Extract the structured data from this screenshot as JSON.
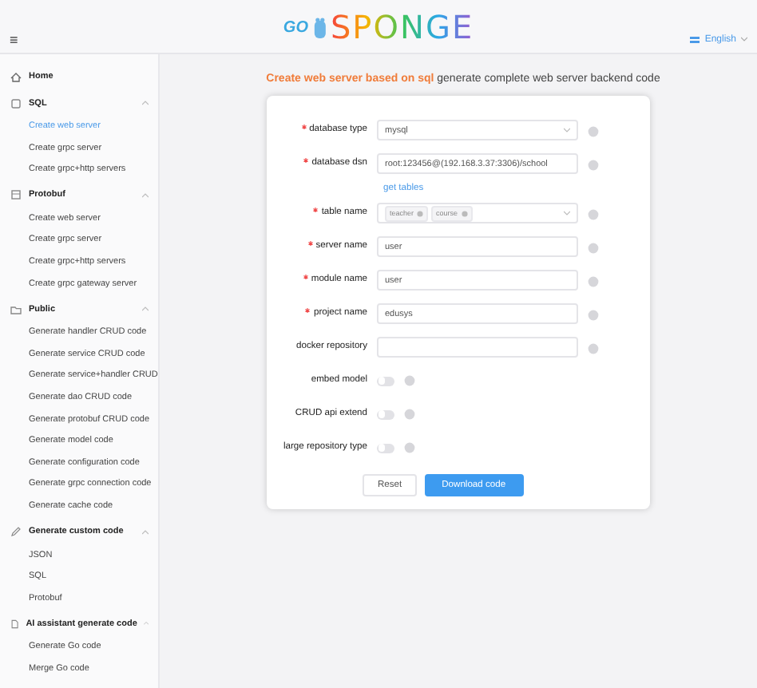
{
  "header": {
    "menu_icon": "≡",
    "logo": {
      "go": "GO",
      "name": "SPONGE"
    },
    "language": "English"
  },
  "sidebar": {
    "items": [
      {
        "label": "Home",
        "kind": "link",
        "selected": false
      },
      {
        "label": "SQL",
        "kind": "group",
        "expanded": true,
        "children": [
          {
            "label": "Create web server",
            "selected": true
          },
          {
            "label": "Create grpc server",
            "selected": false
          },
          {
            "label": "Create grpc+http servers",
            "selected": false
          }
        ]
      },
      {
        "label": "Protobuf",
        "kind": "group",
        "expanded": true,
        "children": [
          {
            "label": "Create web server",
            "selected": false
          },
          {
            "label": "Create grpc server",
            "selected": false
          },
          {
            "label": "Create grpc+http servers",
            "selected": false
          },
          {
            "label": "Create grpc gateway server",
            "selected": false
          }
        ]
      },
      {
        "label": "Public",
        "kind": "group",
        "expanded": true,
        "children": [
          {
            "label": "Generate handler CRUD code",
            "selected": false
          },
          {
            "label": "Generate service CRUD code",
            "selected": false
          },
          {
            "label": "Generate service+handler CRUD",
            "selected": false
          },
          {
            "label": "Generate dao CRUD code",
            "selected": false
          },
          {
            "label": "Generate protobuf CRUD code",
            "selected": false
          },
          {
            "label": "Generate model code",
            "selected": false
          },
          {
            "label": "Generate configuration code",
            "selected": false
          },
          {
            "label": "Generate grpc connection code",
            "selected": false
          },
          {
            "label": "Generate cache code",
            "selected": false
          }
        ]
      },
      {
        "label": "Generate custom code",
        "kind": "group",
        "expanded": true,
        "children": [
          {
            "label": "JSON",
            "selected": false
          },
          {
            "label": "SQL",
            "selected": false
          },
          {
            "label": "Protobuf",
            "selected": false
          }
        ]
      },
      {
        "label": "AI assistant generate code",
        "kind": "group",
        "expanded": true,
        "children": [
          {
            "label": "Generate Go code",
            "selected": false
          },
          {
            "label": "Merge Go code",
            "selected": false
          }
        ]
      }
    ]
  },
  "page": {
    "title": {
      "highlight": "Create web server based on sql",
      "rest": "generate complete web server backend code"
    }
  },
  "form": {
    "fields": [
      {
        "kind": "select",
        "label": "database type",
        "required": true,
        "value": "mysql"
      },
      {
        "kind": "input",
        "label": "database dsn",
        "required": true,
        "value": "root:123456@(192.168.3.37:3306)/school",
        "link": "get tables"
      },
      {
        "kind": "tags",
        "label": "table name",
        "required": true,
        "tags": [
          "teacher",
          "course"
        ]
      },
      {
        "kind": "input",
        "label": "server name",
        "required": true,
        "value": "user"
      },
      {
        "kind": "input",
        "label": "module name",
        "required": true,
        "value": "user"
      },
      {
        "kind": "input",
        "label": "project name",
        "required": true,
        "value": "edusys"
      },
      {
        "kind": "input",
        "label": "docker repository",
        "required": false
      },
      {
        "kind": "switch",
        "label": "embed model",
        "required": false,
        "on": false
      },
      {
        "kind": "switch",
        "label": "CRUD api extend",
        "required": false,
        "on": false
      },
      {
        "kind": "switch",
        "label": "large repository type",
        "required": false,
        "on": false
      }
    ],
    "buttons": [
      {
        "label": "Reset",
        "kind": "default"
      },
      {
        "label": "Download code",
        "kind": "primary"
      }
    ]
  }
}
